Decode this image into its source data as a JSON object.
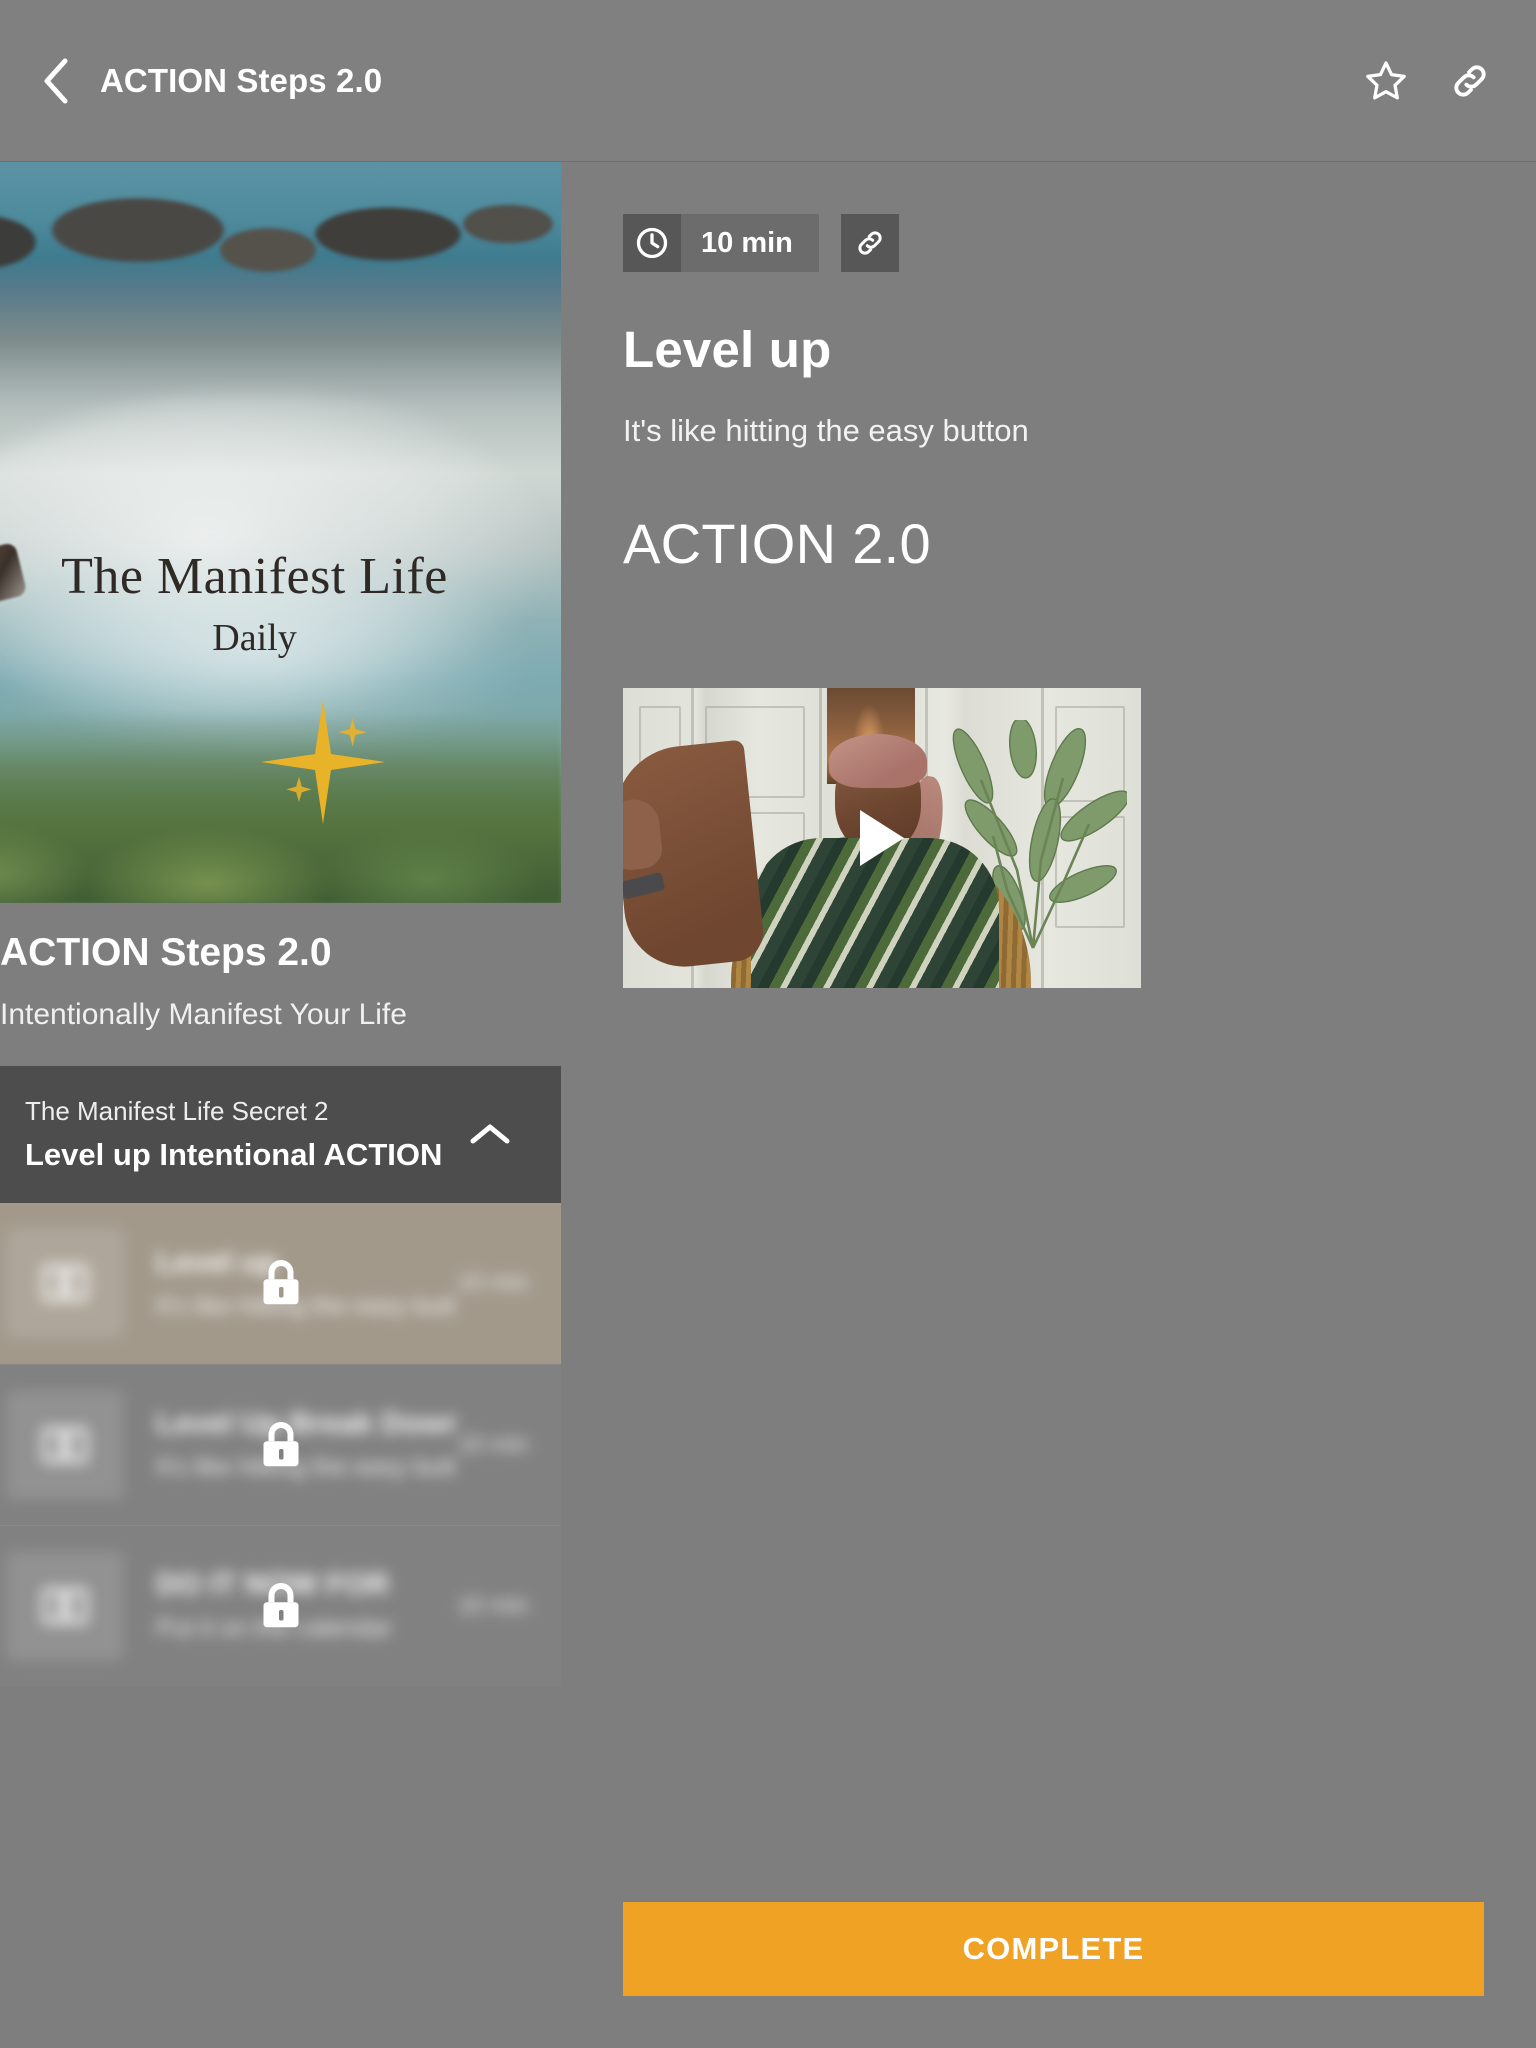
{
  "header": {
    "title": "ACTION Steps 2.0",
    "back_icon": "chevron-left-icon",
    "favorite_icon": "star-outline-icon",
    "share_icon": "link-icon"
  },
  "sidebar": {
    "hero_image": {
      "title": "The Manifest Life",
      "subtitle": "Daily",
      "sparkle_icon": "sparkle-star-icon"
    },
    "course_name": "ACTION Steps 2.0",
    "course_tagline": "Intentionally Manifest Your Life",
    "section": {
      "kicker": "The Manifest Life Secret 2",
      "title": "Level up Intentional ACTION",
      "collapse_icon": "chevron-up-icon",
      "expanded": true
    },
    "lessons": [
      {
        "title": "Level up",
        "subtitle": "It's like hitting the easy button",
        "duration": "10 min",
        "thumb_icon": "book-icon",
        "lock_icon": "lock-icon",
        "active": true,
        "locked": true
      },
      {
        "title": "Level Up Break Down",
        "subtitle": "It's like hitting the easy button",
        "duration": "10 min",
        "thumb_icon": "book-icon",
        "lock_icon": "lock-icon",
        "active": false,
        "locked": true
      },
      {
        "title": "DO IT NOW FOR",
        "subtitle": "Put it on the calendar",
        "duration": "10 min",
        "thumb_icon": "book-icon",
        "lock_icon": "lock-icon",
        "active": false,
        "locked": true
      }
    ]
  },
  "main": {
    "duration_badge": {
      "icon": "clock-icon",
      "text": "10 min"
    },
    "share_button_icon": "link-icon",
    "lesson_title": "Level up",
    "lesson_subtitle": "It's like hitting the easy button",
    "content_heading": "ACTION 2.0",
    "video": {
      "play_icon": "play-triangle-icon"
    },
    "complete_button": {
      "label": "COMPLETE",
      "color": "#F0A224"
    }
  },
  "colors": {
    "page_background": "#7e7e7e",
    "header_background": "#808080",
    "section_header": "#4d4d4d",
    "active_lesson": "#a2998b",
    "badge_dark": "#575757",
    "badge_mid": "#6c6c6c",
    "accent_orange": "#F0A224"
  }
}
